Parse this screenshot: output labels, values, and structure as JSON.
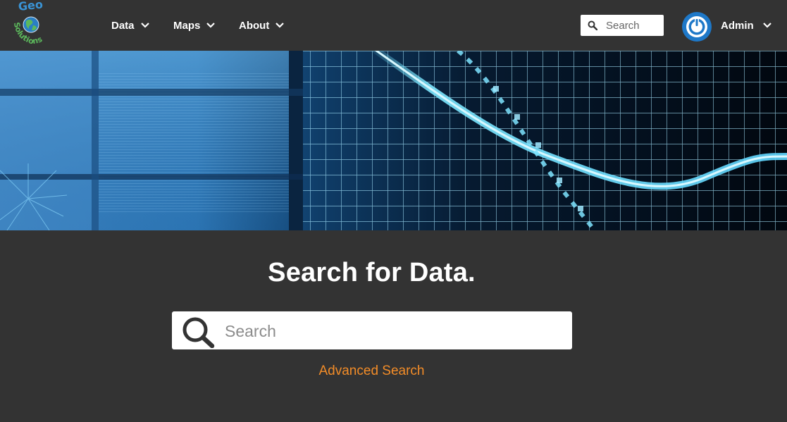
{
  "brand": {
    "logo_top_text": "Geo",
    "logo_bottom_text": "Solutions"
  },
  "nav": {
    "items": [
      {
        "label": "Data"
      },
      {
        "label": "Maps"
      },
      {
        "label": "About"
      }
    ]
  },
  "header_search": {
    "placeholder": "Search"
  },
  "user": {
    "name": "Admin",
    "avatar_icon": "power-icon"
  },
  "main": {
    "title": "Search for Data.",
    "search_placeholder": "Search",
    "advanced_search_label": "Advanced Search"
  },
  "colors": {
    "background": "#333333",
    "accent": "#f28c28",
    "avatar_blue": "#1e78c8"
  }
}
